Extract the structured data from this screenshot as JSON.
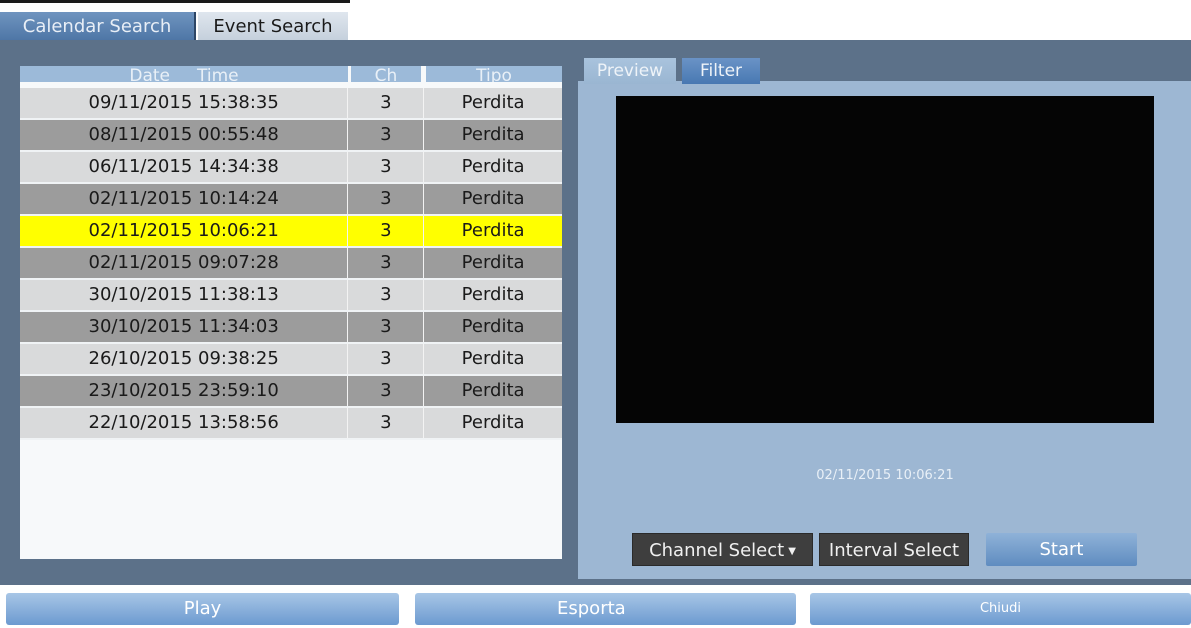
{
  "top_tabs": {
    "calendar_search": "Calendar Search",
    "event_search": "Event Search",
    "active": "Event Search"
  },
  "table": {
    "headers": {
      "date": "Date",
      "time": "Time",
      "channel": "Ch",
      "type": "Tipo"
    },
    "rows": [
      {
        "datetime": "09/11/2015 15:38:35",
        "ch": "3",
        "type": "Perdita"
      },
      {
        "datetime": "08/11/2015 00:55:48",
        "ch": "3",
        "type": "Perdita"
      },
      {
        "datetime": "06/11/2015 14:34:38",
        "ch": "3",
        "type": "Perdita"
      },
      {
        "datetime": "02/11/2015 10:14:24",
        "ch": "3",
        "type": "Perdita"
      },
      {
        "datetime": "02/11/2015 10:06:21",
        "ch": "3",
        "type": "Perdita"
      },
      {
        "datetime": "02/11/2015 09:07:28",
        "ch": "3",
        "type": "Perdita"
      },
      {
        "datetime": "30/10/2015 11:38:13",
        "ch": "3",
        "type": "Perdita"
      },
      {
        "datetime": "30/10/2015 11:34:03",
        "ch": "3",
        "type": "Perdita"
      },
      {
        "datetime": "26/10/2015 09:38:25",
        "ch": "3",
        "type": "Perdita"
      },
      {
        "datetime": "23/10/2015 23:59:10",
        "ch": "3",
        "type": "Perdita"
      },
      {
        "datetime": "22/10/2015 13:58:56",
        "ch": "3",
        "type": "Perdita"
      }
    ],
    "selected_index": 4
  },
  "preview": {
    "tabs": {
      "preview": "Preview",
      "filter": "Filter"
    },
    "active_tab": "Preview",
    "timestamp": "02/11/2015 10:06:21",
    "channel_select": "Channel Select",
    "interval_select": "Interval Select",
    "start": "Start"
  },
  "bottom": {
    "play": "Play",
    "export": "Esporta",
    "close": "Chiudi"
  },
  "colors": {
    "selected_row": "#ffff00",
    "panel": "#5c7189",
    "preview_panel": "#9db7d3"
  }
}
